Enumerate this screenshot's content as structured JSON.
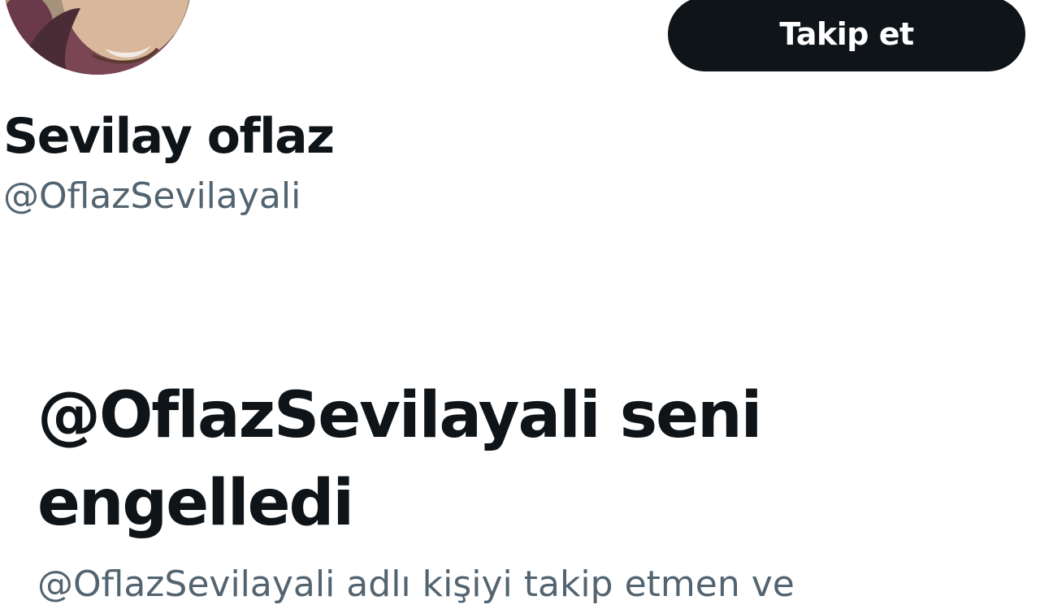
{
  "profile": {
    "display_name": "Sevilay oflaz",
    "handle": "@OflazSevilayali",
    "avatar_icon": "profile-photo"
  },
  "actions": {
    "follow_label": "Takip et"
  },
  "blocked": {
    "title": "@OflazSevilayali seni engelledi",
    "description": "@OflazSevilayali adlı kişiyi takip etmen ve"
  },
  "colors": {
    "primary_text": "#0f1419",
    "secondary_text": "#536471",
    "button_bg": "#0f1419",
    "button_text": "#ffffff",
    "background": "#ffffff"
  }
}
